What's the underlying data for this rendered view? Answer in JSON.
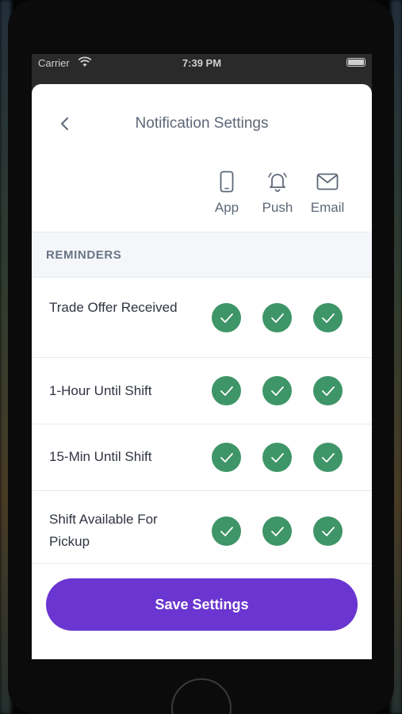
{
  "status_bar": {
    "carrier": "Carrier",
    "time": "7:39 PM"
  },
  "header": {
    "title": "Notification Settings",
    "back_icon": "chevron-left-icon"
  },
  "channels": [
    {
      "label": "App",
      "icon": "phone-icon"
    },
    {
      "label": "Push",
      "icon": "bell-icon"
    },
    {
      "label": "Email",
      "icon": "envelope-icon"
    }
  ],
  "section": {
    "title": "REMINDERS"
  },
  "reminders": [
    {
      "label": "Trade Offer Received",
      "app": true,
      "push": true,
      "email": true
    },
    {
      "label": "1-Hour Until Shift",
      "app": true,
      "push": true,
      "email": true
    },
    {
      "label": "15-Min Until Shift",
      "app": true,
      "push": true,
      "email": true
    },
    {
      "label": "Shift Available For Pickup",
      "app": true,
      "push": true,
      "email": true
    }
  ],
  "footer": {
    "save_label": "Save Settings"
  },
  "colors": {
    "accent": "#6a35d0",
    "check": "#3e9567",
    "title": "#5e6778"
  }
}
